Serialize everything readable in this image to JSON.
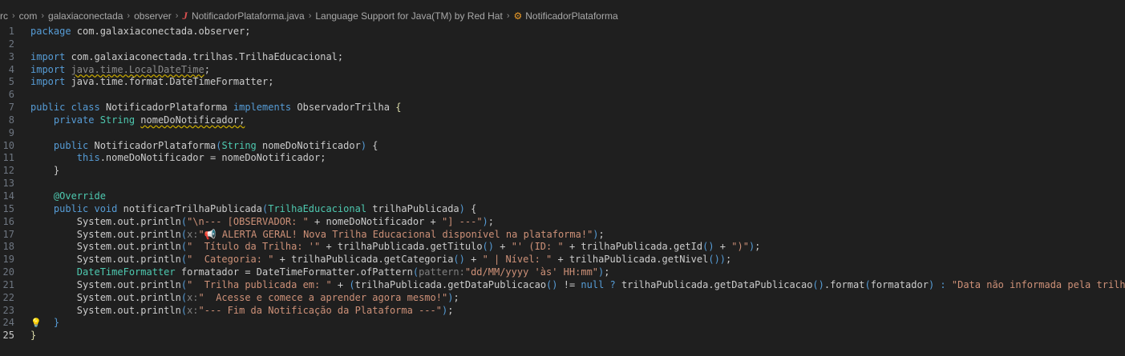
{
  "breadcrumb": {
    "items": [
      "rc",
      "com",
      "galaxiaconectada",
      "observer",
      "NotificadorPlataforma.java",
      "Language Support for Java(TM) by Red Hat",
      "NotificadorPlataforma"
    ]
  },
  "editor": {
    "line_numbers": [
      "1",
      "2",
      "3",
      "4",
      "5",
      "6",
      "7",
      "8",
      "9",
      "10",
      "11",
      "12",
      "13",
      "14",
      "15",
      "16",
      "17",
      "18",
      "19",
      "20",
      "21",
      "22",
      "23",
      "24",
      "25"
    ],
    "lines": [
      [
        [
          "k",
          "package "
        ],
        [
          "p",
          "com.galaxiaconectada.observer;"
        ]
      ],
      [],
      [
        [
          "k",
          "import "
        ],
        [
          "p",
          "com.galaxiaconectada.trilhas.TrilhaEducacional;"
        ]
      ],
      [
        [
          "k",
          "import "
        ],
        [
          "gray",
          "java.time.LocalDateTime"
        ],
        [
          "p",
          ";"
        ]
      ],
      [
        [
          "k",
          "import "
        ],
        [
          "p",
          "java.time.format.DateTimeFormatter;"
        ]
      ],
      [],
      [
        [
          "k",
          "public "
        ],
        [
          "k",
          "class "
        ],
        [
          "p",
          "NotificadorPlataforma "
        ],
        [
          "k",
          "implements "
        ],
        [
          "p",
          "ObservadorTrilha "
        ],
        [
          "a",
          "{"
        ]
      ],
      [
        [
          "p",
          "    "
        ],
        [
          "k",
          "private "
        ],
        [
          "t",
          "String "
        ],
        [
          "p",
          "nomeDoNotificador;"
        ]
      ],
      [],
      [
        [
          "p",
          "    "
        ],
        [
          "k",
          "public "
        ],
        [
          "p",
          "NotificadorPlataforma"
        ],
        [
          "pk",
          "("
        ],
        [
          "t",
          "String "
        ],
        [
          "p",
          "nomeDoNotificador"
        ],
        [
          "pk",
          ")"
        ],
        [
          "p",
          " {"
        ]
      ],
      [
        [
          "p",
          "        "
        ],
        [
          "k",
          "this"
        ],
        [
          "p",
          ".nomeDoNotificador = nomeDoNotificador;"
        ]
      ],
      [
        [
          "p",
          "    "
        ],
        [
          "p",
          "}"
        ]
      ],
      [],
      [
        [
          "p",
          "    "
        ],
        [
          "t",
          "@Override"
        ]
      ],
      [
        [
          "p",
          "    "
        ],
        [
          "k",
          "public "
        ],
        [
          "k",
          "void "
        ],
        [
          "p",
          "notificarTrilhaPublicada"
        ],
        [
          "pk",
          "("
        ],
        [
          "t",
          "TrilhaEducacional "
        ],
        [
          "p",
          "trilhaPublicada"
        ],
        [
          "pk",
          ")"
        ],
        [
          "p",
          " {"
        ]
      ],
      [
        [
          "p",
          "        System.out.println"
        ],
        [
          "pk",
          "("
        ],
        [
          "s",
          "\"\\n--- [OBSERVADOR: \""
        ],
        [
          "p",
          " + nomeDoNotificador + "
        ],
        [
          "s",
          "\"] ---\""
        ],
        [
          "pk",
          ")"
        ],
        [
          "p",
          ";"
        ]
      ],
      [
        [
          "p",
          "        System.out.println"
        ],
        [
          "pk",
          "("
        ],
        [
          "h",
          "x:"
        ],
        [
          "s",
          "\"📢 ALERTA GERAL! Nova Trilha Educacional disponível na plataforma!\""
        ],
        [
          "pk",
          ")"
        ],
        [
          "p",
          ";"
        ]
      ],
      [
        [
          "p",
          "        System.out.println"
        ],
        [
          "pk",
          "("
        ],
        [
          "s",
          "\"  Título da Trilha: '\""
        ],
        [
          "p",
          " + trilhaPublicada.getTitulo"
        ],
        [
          "pk",
          "()"
        ],
        [
          "p",
          " + "
        ],
        [
          "s",
          "\"' (ID: \""
        ],
        [
          "p",
          " + trilhaPublicada.getId"
        ],
        [
          "pk",
          "()"
        ],
        [
          "p",
          " + "
        ],
        [
          "s",
          "\")\""
        ],
        [
          "pk",
          ")"
        ],
        [
          "p",
          ";"
        ]
      ],
      [
        [
          "p",
          "        System.out.println"
        ],
        [
          "pk",
          "("
        ],
        [
          "s",
          "\"  Categoria: \""
        ],
        [
          "p",
          " + trilhaPublicada.getCategoria"
        ],
        [
          "pk",
          "()"
        ],
        [
          "p",
          " + "
        ],
        [
          "s",
          "\" | Nível: \""
        ],
        [
          "p",
          " + trilhaPublicada.getNivel"
        ],
        [
          "pk",
          "()"
        ],
        [
          "pk",
          ")"
        ],
        [
          "p",
          ";"
        ]
      ],
      [
        [
          "p",
          "        "
        ],
        [
          "t",
          "DateTimeFormatter "
        ],
        [
          "p",
          "formatador = DateTimeFormatter.ofPattern"
        ],
        [
          "pk",
          "("
        ],
        [
          "h",
          "pattern:"
        ],
        [
          "s",
          "\"dd/MM/yyyy 'às' HH:mm\""
        ],
        [
          "pk",
          ")"
        ],
        [
          "p",
          ";"
        ]
      ],
      [
        [
          "p",
          "        System.out.println"
        ],
        [
          "pk",
          "("
        ],
        [
          "s",
          "\"  Trilha publicada em: \""
        ],
        [
          "p",
          " + "
        ],
        [
          "pk",
          "("
        ],
        [
          "p",
          "trilhaPublicada.getDataPublicacao"
        ],
        [
          "pk",
          "()"
        ],
        [
          "p",
          " != "
        ],
        [
          "k",
          "null"
        ],
        [
          "p",
          " "
        ],
        [
          "k",
          "?"
        ],
        [
          "p",
          " trilhaPublicada.getDataPublicacao"
        ],
        [
          "pk",
          "()"
        ],
        [
          "p",
          ".format"
        ],
        [
          "pk",
          "("
        ],
        [
          "p",
          "formatador"
        ],
        [
          "pk",
          ")"
        ],
        [
          "p",
          " "
        ],
        [
          "k",
          ":"
        ],
        [
          "p",
          " "
        ],
        [
          "s",
          "\"Data não informada pela trilha\""
        ],
        [
          "pk",
          "))"
        ],
        [
          "p",
          ";"
        ]
      ],
      [
        [
          "p",
          "        System.out.println"
        ],
        [
          "pk",
          "("
        ],
        [
          "h",
          "x:"
        ],
        [
          "s",
          "\"  Acesse e comece a aprender agora mesmo!\""
        ],
        [
          "pk",
          ")"
        ],
        [
          "p",
          ";"
        ]
      ],
      [
        [
          "p",
          "        System.out.println"
        ],
        [
          "pk",
          "("
        ],
        [
          "h",
          "x:"
        ],
        [
          "s",
          "\"--- Fim da Notificação da Plataforma ---\""
        ],
        [
          "pk",
          ")"
        ],
        [
          "p",
          ";"
        ]
      ],
      [
        [
          "p",
          "    "
        ],
        [
          "k",
          "}"
        ]
      ],
      [
        [
          "a",
          "}"
        ]
      ]
    ]
  }
}
